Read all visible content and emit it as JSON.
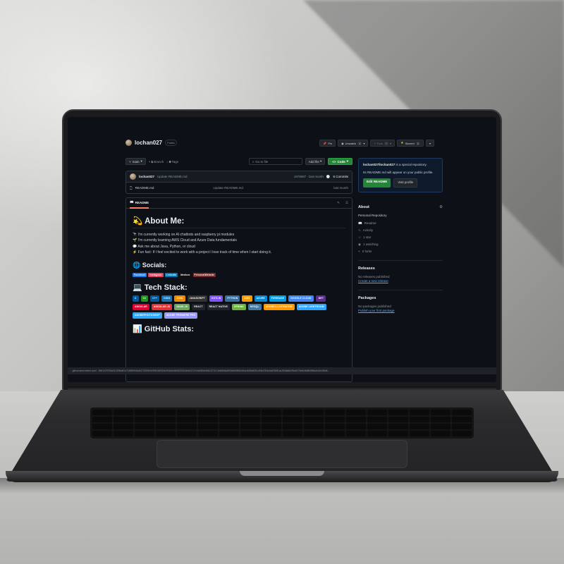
{
  "repo": {
    "owner": "lochan027",
    "visibility": "Public",
    "buttons": {
      "pin": "Pin",
      "unwatch": "Unwatch",
      "unwatch_count": "1",
      "fork": "Fork",
      "fork_count": "0",
      "starred": "Starred",
      "star_count": "1"
    }
  },
  "toolbar": {
    "branch": "main",
    "branches_count": "1",
    "branches_label": "Branch",
    "tags_count": "0",
    "tags_label": "Tags",
    "goto_placeholder": "Go to file",
    "add_file": "Add file",
    "code": "Code"
  },
  "files": {
    "commit": {
      "user": "lochan027",
      "message": "Update README.md",
      "hash": "c879697 · last month",
      "commits": "6 Commits"
    },
    "rows": [
      {
        "name": "README.md",
        "message": "Update README.md",
        "date": "last month"
      }
    ]
  },
  "readme": {
    "tab": "README",
    "about_heading": "💫 About Me:",
    "bullets": [
      "🔭 I'm currently working on AI chatbots and raspberry pi modules",
      "🌱 I'm currently learning AWS Cloud and Azure Data fundamentals",
      "💬 Ask me about Java, Python, or cloud",
      "⚡ Fun fact: If I feel excited to work with a project I lose track of time when I start doing it."
    ],
    "socials_heading": "🌐 Socials:",
    "socials": [
      {
        "label": "Facebook",
        "color": "#1877F2"
      },
      {
        "label": "Instagram",
        "color": "#E4405F"
      },
      {
        "label": "LinkedIn",
        "color": "#0077B5"
      },
      {
        "label": "Medium",
        "color": "#12100E"
      },
      {
        "label": "PersonalWebsite",
        "color": "#7a2a2a"
      }
    ],
    "tech_heading": "💻 Tech Stack:",
    "tech": [
      {
        "label": "C",
        "color": "#00599C"
      },
      {
        "label": "C#",
        "color": "#239120"
      },
      {
        "label": "C++",
        "color": "#00599C"
      },
      {
        "label": "CSS3",
        "color": "#1572B6"
      },
      {
        "label": "JAVA",
        "color": "#ED8B00"
      },
      {
        "label": "JAVASCRIPT",
        "color": "#323330"
      },
      {
        "label": "KOTLIN",
        "color": "#7F52FF"
      },
      {
        "label": "PYTHON",
        "color": "#3670A0"
      },
      {
        "label": "AWS",
        "color": "#FF9900"
      },
      {
        "label": "AZURE",
        "color": "#0089D6"
      },
      {
        "label": "FIREBASE",
        "color": "#039BE5"
      },
      {
        "label": "GOOGLE CLOUD",
        "color": "#4285F4"
      },
      {
        "label": ".NET",
        "color": "#5C2D91"
      },
      {
        "label": "ANGULAR",
        "color": "#DD0031"
      },
      {
        "label": "ANGULAR.JS",
        "color": "#E23237"
      },
      {
        "label": "NODE.JS",
        "color": "#6DA55F"
      },
      {
        "label": "REACT",
        "color": "#20232A"
      },
      {
        "label": "REACT NATIVE",
        "color": "#20232A"
      },
      {
        "label": "SPRING",
        "color": "#6DB33F"
      },
      {
        "label": "MYSQL",
        "color": "#4479A1"
      },
      {
        "label": "ADOBEILLUSTRATOR",
        "color": "#FF9A00"
      },
      {
        "label": "ADOBE LIGHTROOM",
        "color": "#31A8FF"
      },
      {
        "label": "ADOBEPHOTOSHOP",
        "color": "#31A8FF"
      },
      {
        "label": "ADOBE PREMIERE PRO",
        "color": "#9999FF"
      }
    ],
    "stats_heading": "📊 GitHub Stats:"
  },
  "sidebar": {
    "special_title": "lochan027/lochan027",
    "special_text": " is a special repository.",
    "special_text2": "Its README.md will appear on your public profile.",
    "edit_readme": "Edit README",
    "visit_profile": "Visit profile",
    "about_title": "About",
    "about_desc": "Personal Repository",
    "about_items": [
      "Readme",
      "Activity",
      "1 star",
      "1 watching",
      "0 forks"
    ],
    "releases_title": "Releases",
    "releases_none": "No releases published",
    "releases_link": "Create a new release",
    "packages_title": "Packages",
    "packages_none": "No packages published",
    "packages_link": "Publish your first package"
  },
  "statusbar": {
    "url": "...githubusercontent.com/...9b91476705a31249fbd67a7186999d6c6473329b90/f2f8168784b2f04d6d0626253216e616747d4e98/6e50b2373174d8f2b8a8f22d6b9862e8f4c4b85a8261c53b2304c6d6768f1ac2f5/8a8b2f9cdf176e8c8fd8f4ff66cfc16e4f8d6..."
  }
}
